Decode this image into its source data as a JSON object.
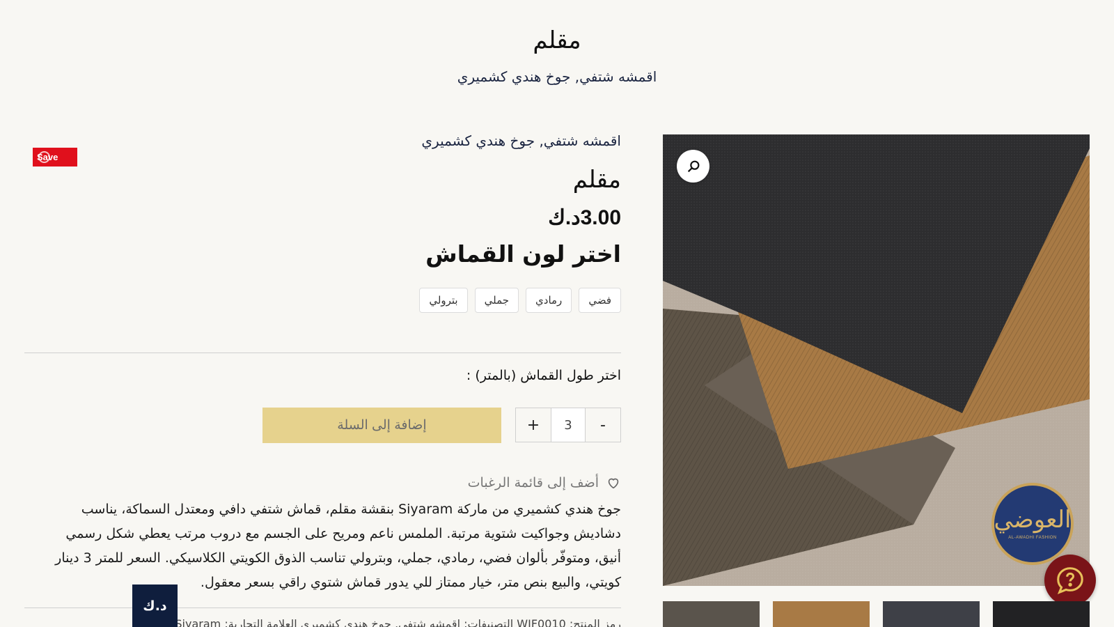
{
  "header": {
    "title": "مقلم",
    "subtitle": "اقمشه شتفي, جوخ هندي كشميري"
  },
  "badge": {
    "save_label": "Save"
  },
  "product": {
    "category_line": "اقمشه شتفي, جوخ هندي كشميري",
    "name": "مقلم",
    "price": "3.00د.ك",
    "choose_color_label": "اختر لون القماش",
    "colors": [
      "فضي",
      "رمادي",
      "جملي",
      "بترولي"
    ],
    "length_label": "اختر طول القماش (بالمتر) :",
    "quantity": "3",
    "minus_label": "-",
    "plus_label": "+",
    "add_to_cart_label": "إضافة إلى السلة",
    "wishlist_label": "أضف إلى قائمة الرغبات",
    "description": "جوخ هندي كشميري من ماركة Siyaram بنقشة مقلم، قماش شتفي دافي ومعتدل السماكة، يناسب دشاديش وجواكيت شتوية مرتبة. الملمس ناعم ومريح على الجسم مع دروب مرتب يعطي شكل رسمي أنيق، ومتوفّر بألوان فضي، رمادي، جملي، وبترولي تناسب الذوق الكويتي الكلاسيكي. السعر للمتر 3 دينار كويتي، والبيع بنص متر، خيار ممتاز للي يدور قماش شتوي راقي بسعر معقول.",
    "meta_line": "رمز المنتج: WIF0010   التصنيفات: اقمشه شتفي, جوخ هندي كشميري   العلامة التجارية: Siyaram"
  },
  "currency_tab": {
    "label": "د.ك"
  },
  "image": {
    "logo_text": "العوضي",
    "logo_caption": "AL-AWADHI FASHION",
    "icons": {
      "zoom": "search-icon",
      "help": "help-chat-icon",
      "wishlist": "heart-icon"
    }
  },
  "colors": {
    "accent_gold": "#e6d28d",
    "navy": "#0f1e3d",
    "save_red": "#e0101c",
    "help_maroon": "#7a1418"
  }
}
